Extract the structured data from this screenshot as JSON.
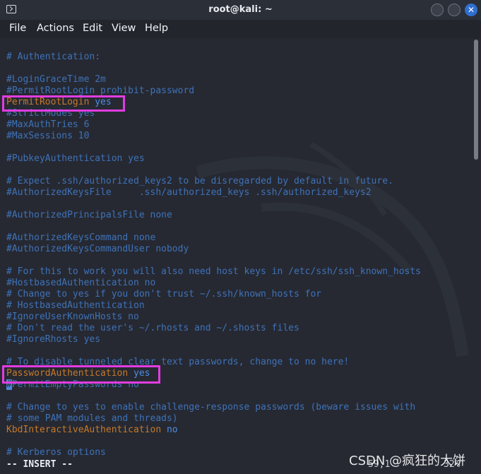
{
  "window": {
    "title": "root@kali: ~",
    "app_icon": "terminal-icon",
    "buttons": {
      "minimize": "minimize-icon",
      "maximize": "maximize-icon",
      "close": "close-icon",
      "close_glyph": "✕"
    }
  },
  "menu": {
    "items": [
      "File",
      "Actions",
      "Edit",
      "View",
      "Help"
    ]
  },
  "editor": {
    "lines": {
      "l0": "# Authentication:",
      "l1": "#LoginGraceTime 2m",
      "l2": "#PermitRootLogin prohibit-password",
      "l3a": "PermitRootLogin",
      "l3b": " yes",
      "l4": "#StrictModes yes",
      "l5": "#MaxAuthTries 6",
      "l6": "#MaxSessions 10",
      "l7": "#PubkeyAuthentication yes",
      "l8": "# Expect .ssh/authorized_keys2 to be disregarded by default in future.",
      "l9": "#AuthorizedKeysFile     .ssh/authorized_keys .ssh/authorized_keys2",
      "l10": "#AuthorizedPrincipalsFile none",
      "l11": "#AuthorizedKeysCommand none",
      "l12": "#AuthorizedKeysCommandUser nobody",
      "l13": "# For this to work you will also need host keys in /etc/ssh/ssh_known_hosts",
      "l14": "#HostbasedAuthentication no",
      "l15": "# Change to yes if you don't trust ~/.ssh/known_hosts for",
      "l16": "# HostbasedAuthentication",
      "l17": "#IgnoreUserKnownHosts no",
      "l18": "# Don't read the user's ~/.rhosts and ~/.shosts files",
      "l19": "#IgnoreRhosts yes",
      "l20": "# To disable tunneled clear text passwords, change to no here!",
      "l21a": "PasswordAuthentication",
      "l21b": " yes",
      "l22a": "#",
      "l22b": "PermitEmptyPasswords no",
      "l23": "# Change to yes to enable challenge-response passwords (beware issues with",
      "l24": "# some PAM modules and threads)",
      "l25a": "KbdInteractiveAuthentication",
      "l25b": " no",
      "l26": "# Kerberos options"
    },
    "mode": "-- INSERT --",
    "cursor_position": "59,1",
    "scroll_percent": "32%",
    "highlight_color": "#e23ce0",
    "comment_color": "#3f72b8",
    "keyword_color": "#c6792a",
    "value_color": "#4e8ee6"
  },
  "watermark": "CSDN @疯狂的大饼"
}
